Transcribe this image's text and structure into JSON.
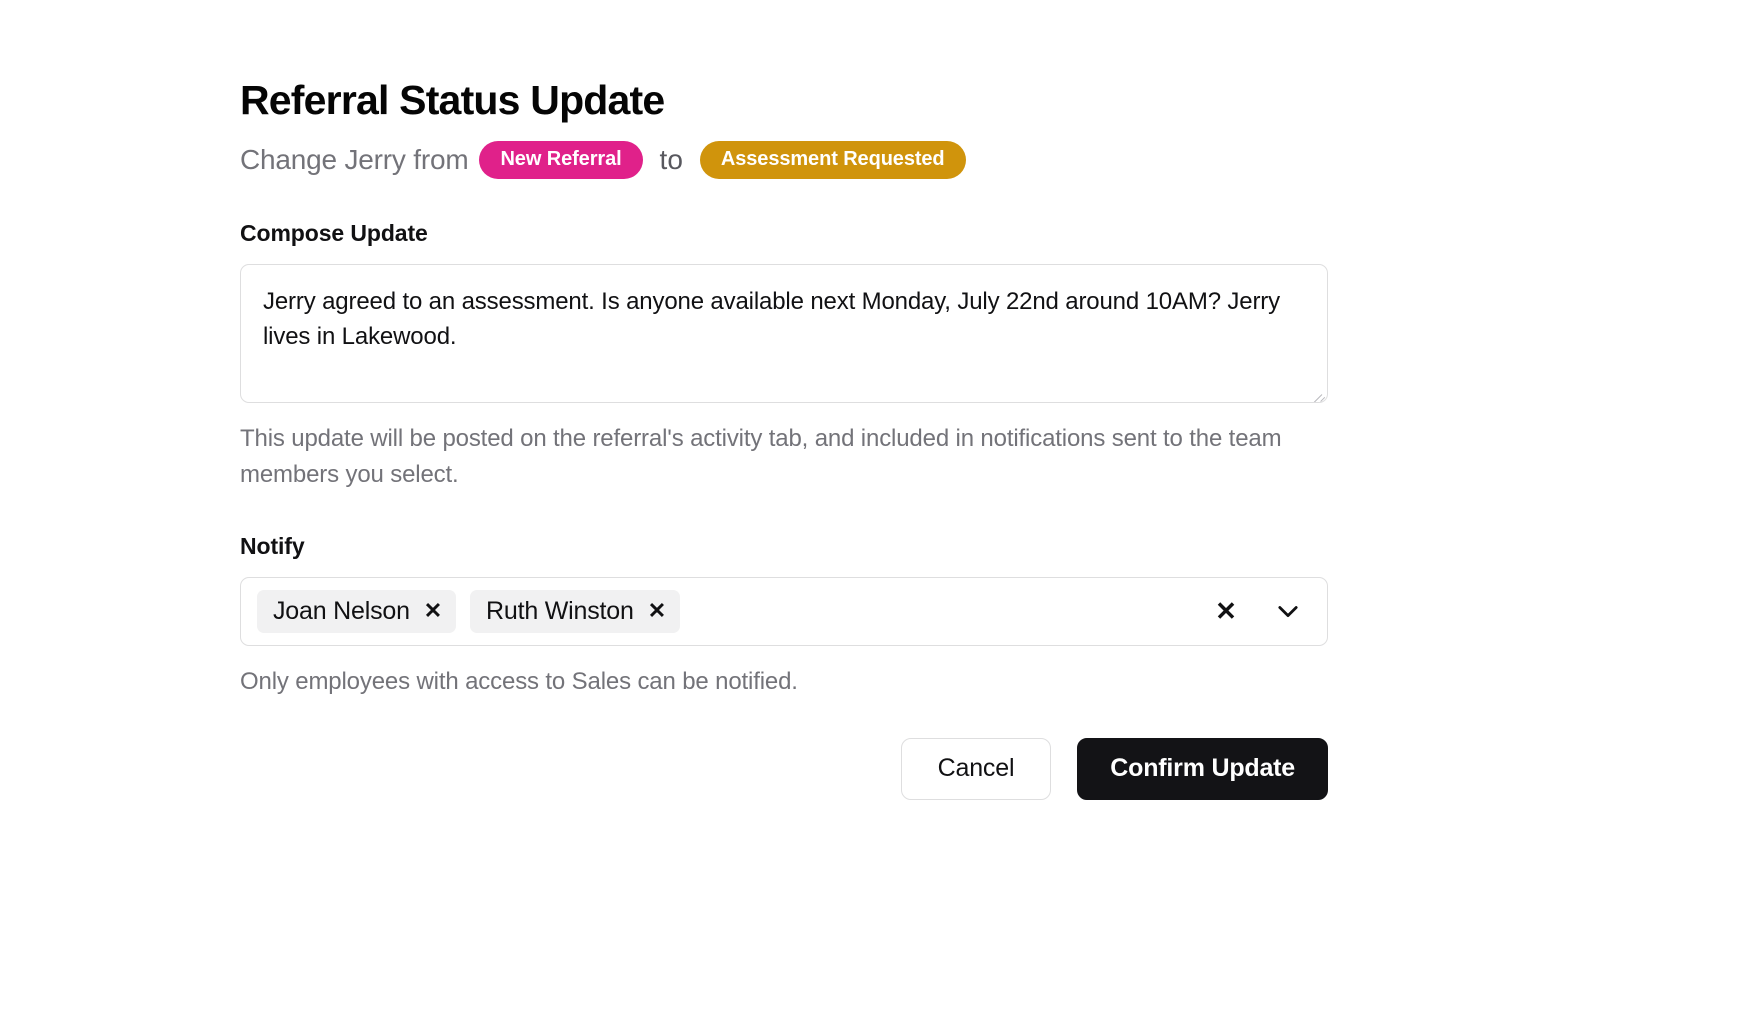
{
  "dialog": {
    "title": "Referral Status Update",
    "subtitle_prefix": "Change Jerry from",
    "subtitle_connector": "to",
    "status_from": "New Referral",
    "status_to": "Assessment Requested",
    "status_from_color": "#E0218A",
    "status_to_color": "#D0940C"
  },
  "compose": {
    "label": "Compose Update",
    "value": "Jerry agreed to an assessment. Is anyone available next Monday, July 22nd around 10AM? Jerry lives in Lakewood.",
    "placeholder": "",
    "help_text": "This update will be posted on the referral's activity tab, and included in notifications sent to the team members you select."
  },
  "notify": {
    "label": "Notify",
    "chips": [
      {
        "name": "Joan Nelson",
        "remove_icon": "✕"
      },
      {
        "name": "Ruth Winston",
        "remove_icon": "✕"
      }
    ],
    "clear_icon": "✕",
    "dropdown_icon": "chevron-down",
    "help_text": "Only employees with access to Sales can be notified."
  },
  "actions": {
    "cancel_label": "Cancel",
    "confirm_label": "Confirm Update"
  }
}
